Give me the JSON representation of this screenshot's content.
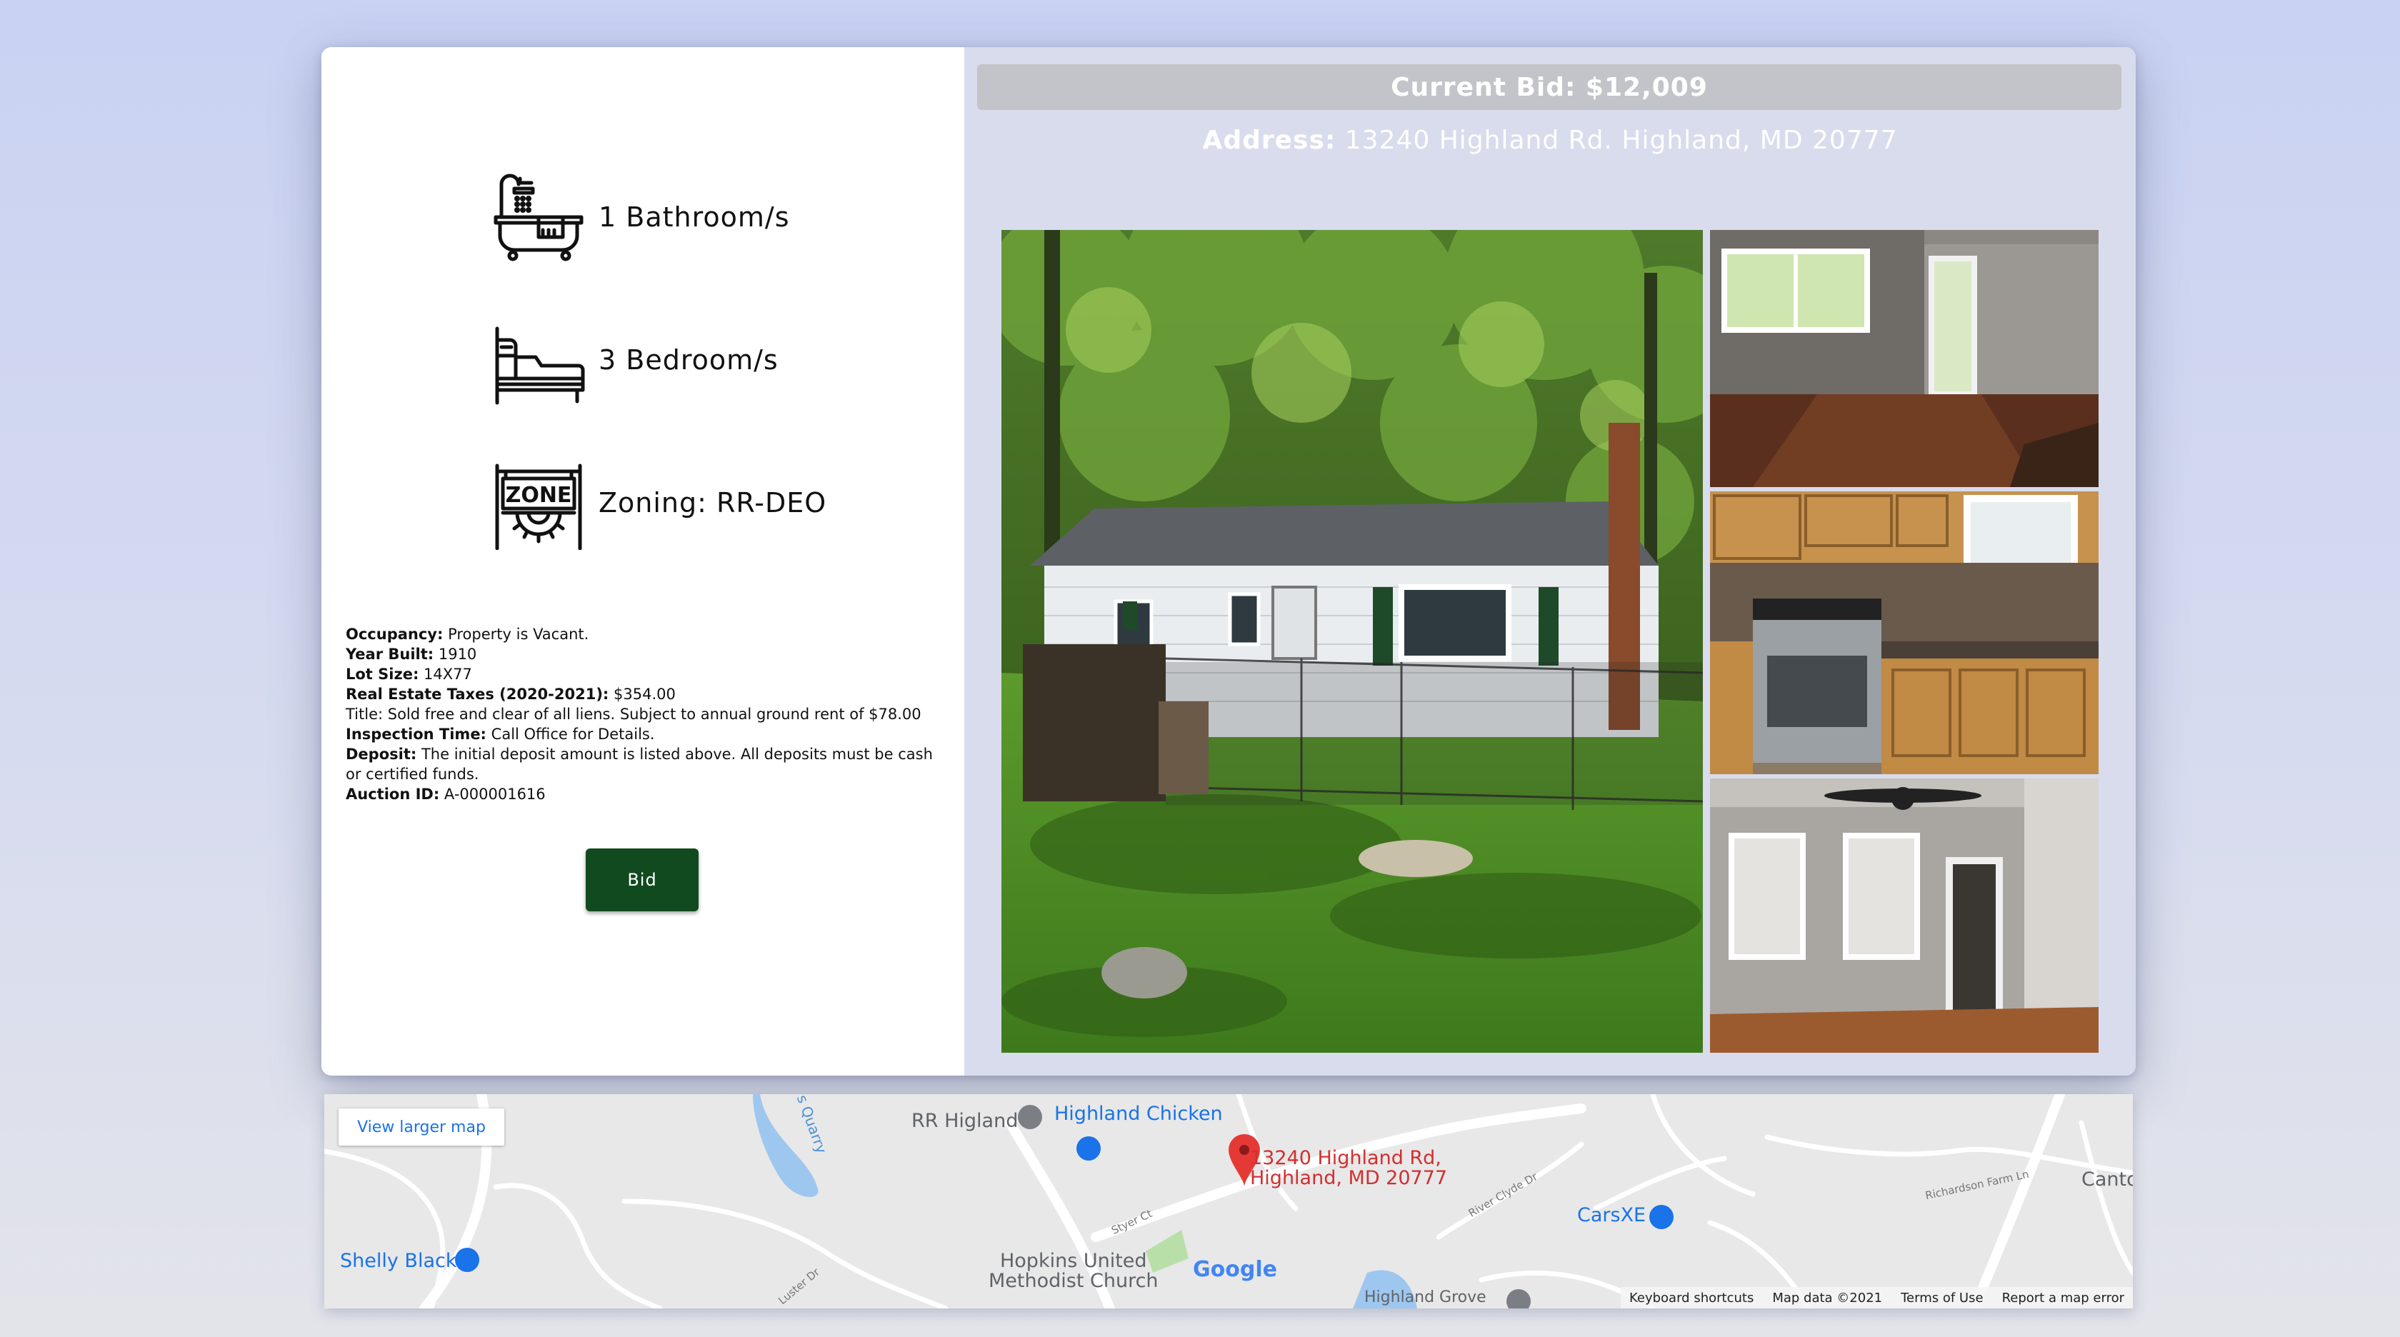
{
  "features": [
    {
      "icon": "bathtub-icon",
      "label": "1 Bathroom/s"
    },
    {
      "icon": "bed-icon",
      "label": "3 Bedroom/s"
    },
    {
      "icon": "zone-sign-icon",
      "label": "Zoning: RR-DEO"
    }
  ],
  "details": {
    "occupancy_label": "Occupancy:",
    "occupancy": "Property is Vacant.",
    "year_label": "Year Built:",
    "year": "1910",
    "lot_label": "Lot Size:",
    "lot": "14X77",
    "taxes_label": "Real Estate Taxes (2020-2021):",
    "taxes": "$354.00",
    "title_text": "Title: Sold free and clear of all liens. Subject to annual ground rent of $78.00",
    "inspection_label": "Inspection Time:",
    "inspection": "Call Office for Details.",
    "deposit_label": "Deposit:",
    "deposit": "The initial deposit amount is listed above. All deposits must be cash or certified funds.",
    "auction_label": "Auction ID:",
    "auction": "A-000001616"
  },
  "bid_button": "Bid",
  "current_bid": "Current Bid: $12,009",
  "address_label": "Address:",
  "address": "13240 Highland Rd. Highland, MD 20777",
  "map": {
    "view_larger": "View larger map",
    "pin_label_line1": "13240 Highland Rd,",
    "pin_label_line2": "Highland, MD 20777",
    "places": {
      "rr_higland": "RR Higland",
      "highland_chicken": "Highland Chicken",
      "carsxe": "CarsXE",
      "shelly_black": "Shelly Black",
      "hopkins1": "Hopkins United",
      "hopkins2": "Methodist Church",
      "canto": "Canto",
      "quarry": "s Quarry",
      "river_clyde": "River Clyde Dr",
      "styer": "Styer Ct",
      "richardson": "Richardson Farm Ln",
      "luster": "Luster Dr",
      "highland_grove": "Highland Grove"
    },
    "google": "Google",
    "footer": {
      "keyboard": "Keyboard shortcuts",
      "mapdata": "Map data ©2021",
      "terms": "Terms of Use",
      "report": "Report a map error"
    }
  },
  "colors": {
    "bid_button": "#114a1e",
    "right_panel": "#d8dced",
    "pin": "#e53935",
    "place_blue": "#1a73e8"
  }
}
